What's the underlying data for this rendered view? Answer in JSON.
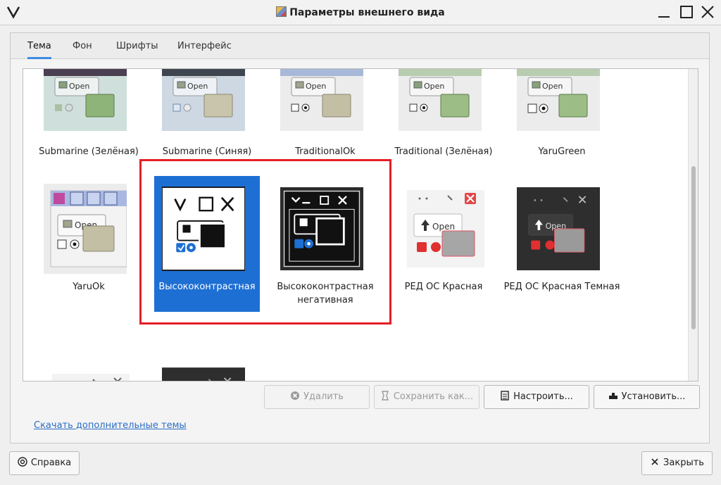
{
  "window": {
    "title": "Параметры внешнего вида"
  },
  "tabs": [
    {
      "label": "Тема",
      "active": true
    },
    {
      "label": "Фон",
      "active": false
    },
    {
      "label": "Шрифты",
      "active": false
    },
    {
      "label": "Интерфейс",
      "active": false
    }
  ],
  "themes": [
    {
      "name": "Submarine (Зелёная)"
    },
    {
      "name": "Submarine (Синяя)"
    },
    {
      "name": "TraditionalOk"
    },
    {
      "name": "Traditional (Зелёная)"
    },
    {
      "name": "YaruGreen"
    },
    {
      "name": "YaruOk"
    },
    {
      "name": "Высококонтрастная",
      "selected": true
    },
    {
      "name": "Высококонтрастная негативная"
    },
    {
      "name": "РЕД ОС Красная"
    },
    {
      "name": "РЕД ОС Красная Темная"
    }
  ],
  "preview": {
    "open_label": "Open"
  },
  "actions": {
    "delete": "Удалить",
    "save_as": "Сохранить как...",
    "customize": "Настроить...",
    "install": "Установить..."
  },
  "download_link": "Скачать дополнительные темы",
  "footer": {
    "help": "Справка",
    "close": "Закрыть"
  },
  "colors": {
    "accent": "#1e6fd3",
    "highlight_box": "#e41e26"
  }
}
